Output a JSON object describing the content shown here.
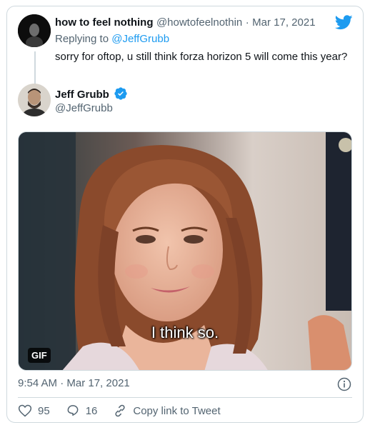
{
  "reply": {
    "display_name": "how to feel nothing",
    "handle": "@howtofeelnothin",
    "separator": "·",
    "date": "Mar 17, 2021",
    "replying_label": "Replying to",
    "replying_handle": "@JeffGrubb",
    "text": "sorry for oftop, u still think forza horizon 5 will come this year?"
  },
  "author": {
    "display_name": "Jeff Grubb",
    "handle": "@JeffGrubb",
    "verified": true
  },
  "media": {
    "caption": "I think so.",
    "badge": "GIF"
  },
  "meta": {
    "timestamp": "9:54 AM · Mar 17, 2021"
  },
  "actions": {
    "likes": "95",
    "replies": "16",
    "copy_link": "Copy link to Tweet"
  },
  "colors": {
    "accent": "#1d9bf0",
    "text": "#0f1419",
    "muted": "#536471",
    "border": "#cfd9de"
  },
  "icons": [
    "twitter-bird-icon",
    "verified-badge-icon",
    "info-icon",
    "heart-icon",
    "reply-icon",
    "link-icon"
  ]
}
